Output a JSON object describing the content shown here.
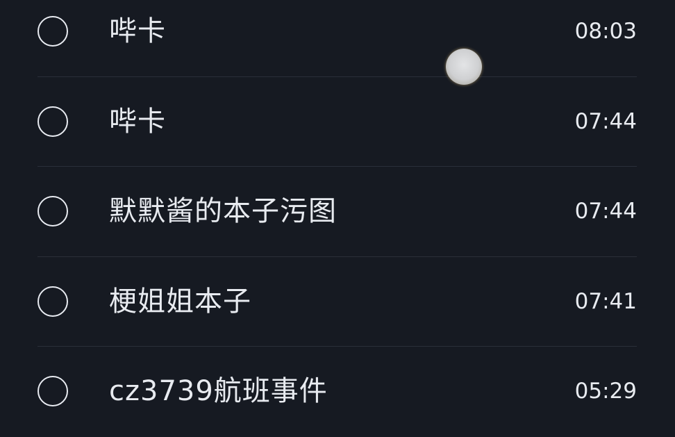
{
  "items": [
    {
      "title": "哔卡",
      "time": "08:03"
    },
    {
      "title": "哔卡",
      "time": "07:44"
    },
    {
      "title": "默默酱的本子污图",
      "time": "07:44"
    },
    {
      "title": "梗姐姐本子",
      "time": "07:41"
    },
    {
      "title": "cz3739航班事件",
      "time": "05:29"
    }
  ]
}
